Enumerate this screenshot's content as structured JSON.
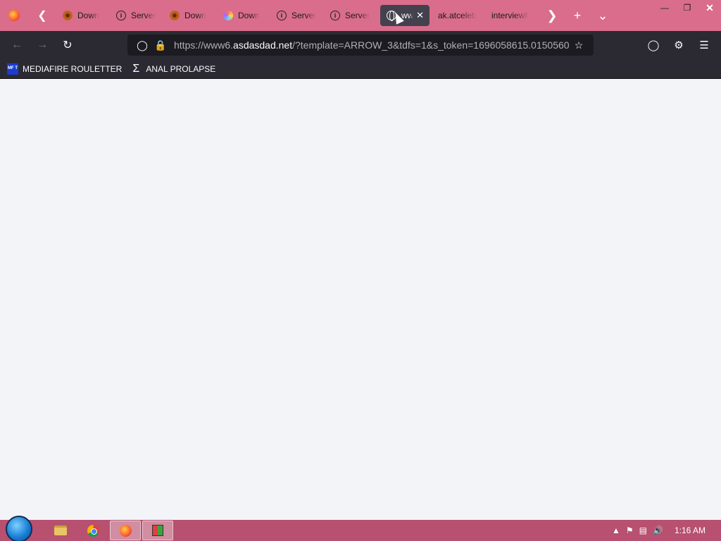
{
  "browser": {
    "tabs": [
      {
        "label": "Down",
        "icon": "gear-favicon-icon",
        "active": false
      },
      {
        "label": "Server",
        "icon": "info-icon",
        "active": false
      },
      {
        "label": "Down",
        "icon": "gear-favicon-icon",
        "active": false
      },
      {
        "label": "Down",
        "icon": "colorful-favicon-icon",
        "active": false
      },
      {
        "label": "Server",
        "icon": "info-icon",
        "active": false
      },
      {
        "label": "Server",
        "icon": "info-icon",
        "active": false
      },
      {
        "label": "ww",
        "icon": "globe-icon",
        "active": true
      },
      {
        "label": "ak.atceleb",
        "icon": "",
        "active": false
      },
      {
        "label": "interviewfi",
        "icon": "",
        "active": false
      }
    ],
    "url": {
      "prefix": "https://www6.",
      "domain": "asdasdad.net",
      "path": "/?template=ARROW_3&tdfs=1&s_token=1696058615.0150560"
    },
    "bookmarks": [
      {
        "label": "MEDIAFIRE ROULETTER",
        "icon": "mediafire-icon",
        "icon_text": "MF T"
      },
      {
        "label": "ANAL PROLAPSE",
        "icon": "sigma-icon",
        "icon_text": "Σ"
      }
    ]
  },
  "taskbar": {
    "clock": "1:16 AM",
    "apps": [
      "file-explorer",
      "chrome",
      "firefox",
      "app"
    ]
  },
  "colors": {
    "titlebar": "#d96d8b",
    "toolbar": "#2b2a33",
    "taskbar": "#b8506f",
    "content": "#f3f4f8"
  }
}
